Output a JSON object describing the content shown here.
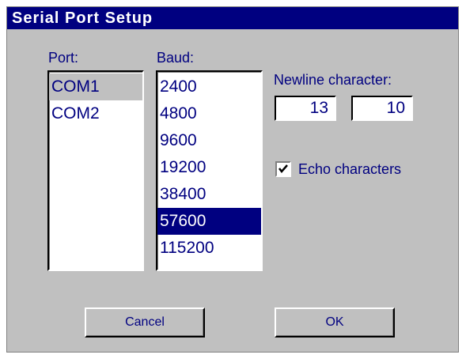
{
  "dialog": {
    "title": "Serial Port Setup",
    "port": {
      "label": "Port:",
      "options": [
        "COM1",
        "COM2"
      ],
      "selected": "COM1"
    },
    "baud": {
      "label": "Baud:",
      "options": [
        "2400",
        "4800",
        "9600",
        "19200",
        "38400",
        "57600",
        "115200"
      ],
      "selected": "57600"
    },
    "newline": {
      "label": "Newline character:",
      "value1": "13",
      "value2": "10"
    },
    "echo": {
      "label": "Echo characters",
      "checked": true
    },
    "buttons": {
      "cancel": "Cancel",
      "ok": "OK"
    }
  },
  "colors": {
    "title_bar": "#000080",
    "dialog_bg": "#c0c0c0",
    "text": "#000080",
    "selection": "#000080"
  }
}
